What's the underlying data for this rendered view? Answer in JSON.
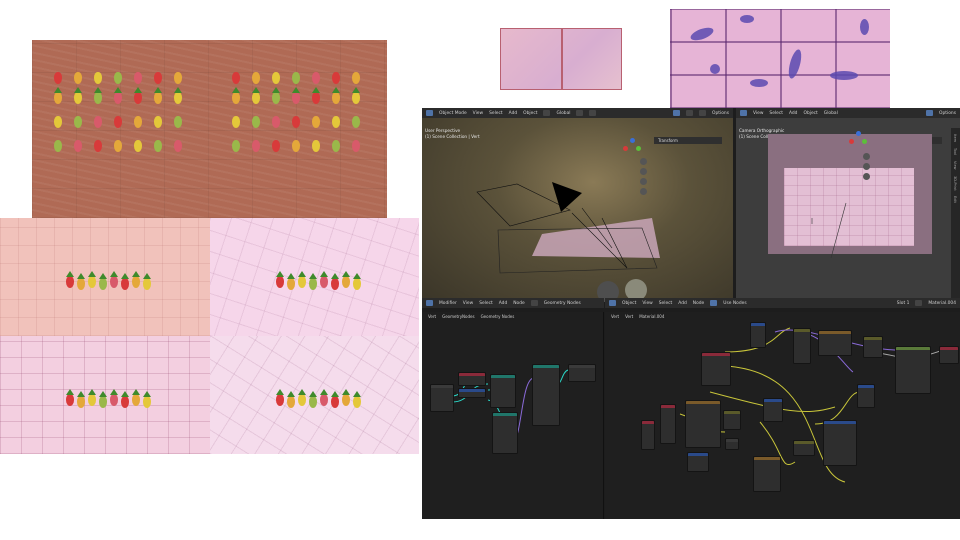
{
  "blender": {
    "viewport_left": {
      "mode": "Object Mode",
      "menu": [
        "View",
        "Select",
        "Add",
        "Object"
      ],
      "transform_orientation": "Global",
      "options": "Options",
      "view_name": "User Perspective",
      "collection": "(1) Scene Collection | Vert",
      "panel": "Transform"
    },
    "viewport_right": {
      "menu": [
        "View",
        "Select",
        "Add",
        "Object"
      ],
      "transform_orientation": "Global",
      "options": "Options",
      "view_name": "Camera Orthographic",
      "collection": "(1) Scene Collection | Vert",
      "panel": "Transform",
      "sidebar_tabs": [
        "Item",
        "Tool",
        "View",
        "3D-Print",
        "Edit"
      ]
    },
    "geometry_nodes_editor": {
      "editor": "Modifier",
      "menu": [
        "View",
        "Select",
        "Add",
        "Node"
      ],
      "tree": "Geometry Nodes",
      "breadcrumb": [
        "Vert",
        "GeometryNodes",
        "Geometry Nodes"
      ]
    },
    "shader_editor": {
      "type": "Object",
      "menu": [
        "View",
        "Select",
        "Add",
        "Node"
      ],
      "use_nodes": "Use Nodes",
      "slot": "Slot 1",
      "material": "Material.004",
      "breadcrumb": [
        "Vert",
        "Vert",
        "Material.004"
      ]
    }
  },
  "colors": {
    "wood": "#b06a55",
    "pink_light": "#f1c2bb",
    "pink_lilac": "#f6d6ea",
    "blender_bg": "#1d1d1d",
    "blender_header": "#2b2b2b",
    "node_geometry": "#20766a",
    "node_input": "#8a2a3a",
    "node_shader": "#5a7a3a",
    "node_texture": "#7a5a2a",
    "wire_yellow": "#c8c53a",
    "wire_purple": "#8a6ad8",
    "wire_teal": "#2ad8c8"
  }
}
